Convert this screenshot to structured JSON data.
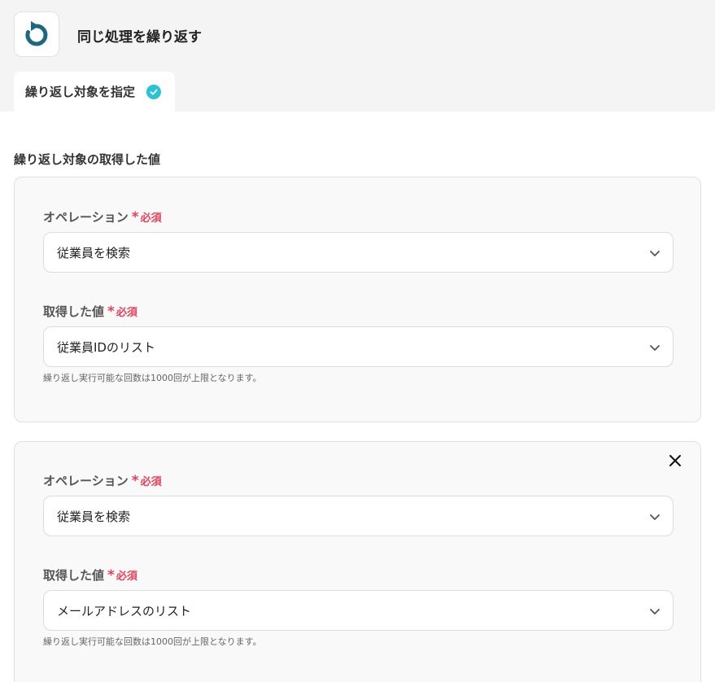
{
  "header": {
    "title": "同じ処理を繰り返す",
    "icon": "loop-arrow-icon",
    "accent_color": "#1f6680"
  },
  "tabs": [
    {
      "label": "繰り返し対象を指定",
      "completed": true
    }
  ],
  "section": {
    "title": "繰り返し対象の取得した値"
  },
  "required_text": "必須",
  "required_star": "*",
  "cards": [
    {
      "operation_label": "オペレーション",
      "operation_value": "従業員を検索",
      "value_label": "取得した値",
      "value_value": "従業員IDのリスト",
      "hint": "繰り返し実行可能な回数は1000回が上限となります。",
      "removable": false
    },
    {
      "operation_label": "オペレーション",
      "operation_value": "従業員を検索",
      "value_label": "取得した値",
      "value_value": "メールアドレスのリスト",
      "hint": "繰り返し実行可能な回数は1000回が上限となります。",
      "removable": true
    }
  ]
}
